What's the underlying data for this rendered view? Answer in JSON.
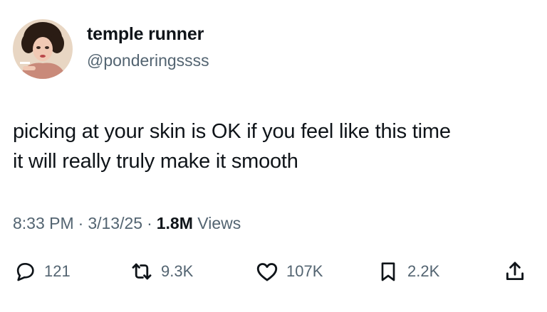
{
  "author": {
    "display_name": "temple runner",
    "handle": "@ponderingssss"
  },
  "tweet": {
    "text_line1": "picking at your skin is OK if you feel like this time",
    "text_line2": "it will really truly make it smooth"
  },
  "meta": {
    "time": "8:33 PM",
    "separator": "·",
    "date": "3/13/25",
    "views_count": "1.8M",
    "views_label": "Views"
  },
  "actions": {
    "replies": {
      "icon": "reply-icon",
      "count": "121"
    },
    "reposts": {
      "icon": "repost-icon",
      "count": "9.3K"
    },
    "likes": {
      "icon": "heart-icon",
      "count": "107K"
    },
    "bookmarks": {
      "icon": "bookmark-icon",
      "count": "2.2K"
    },
    "share": {
      "icon": "share-icon"
    }
  },
  "colors": {
    "text_primary": "#0f1419",
    "text_secondary": "#536471",
    "background": "#ffffff"
  }
}
